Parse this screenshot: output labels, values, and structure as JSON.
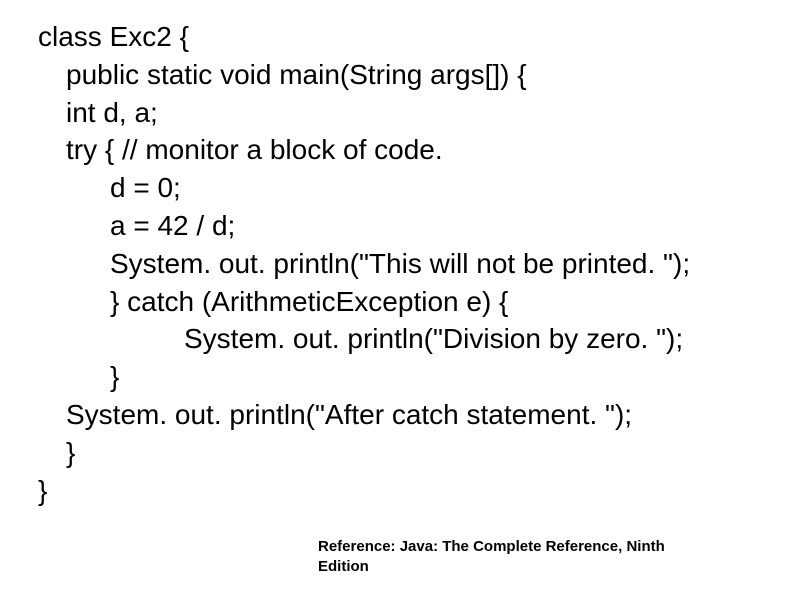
{
  "code": {
    "line1": "class Exc2 {",
    "line2": "public static void main(String args[]) {",
    "line3": "int d, a;",
    "line4": "try { // monitor a block of code.",
    "line5": "d = 0;",
    "line6": "a = 42 / d;",
    "line7": "System. out. println(\"This will not be printed. \");",
    "line8": "} catch (ArithmeticException e) {",
    "line9": "System. out. println(\"Division by zero. \");",
    "line10": "}",
    "line11": "System. out. println(\"After catch statement. \");",
    "line12": "}",
    "line13": "}"
  },
  "reference": {
    "text_line1": "Reference: Java: The Complete Reference, Ninth",
    "text_line2": "Edition"
  }
}
